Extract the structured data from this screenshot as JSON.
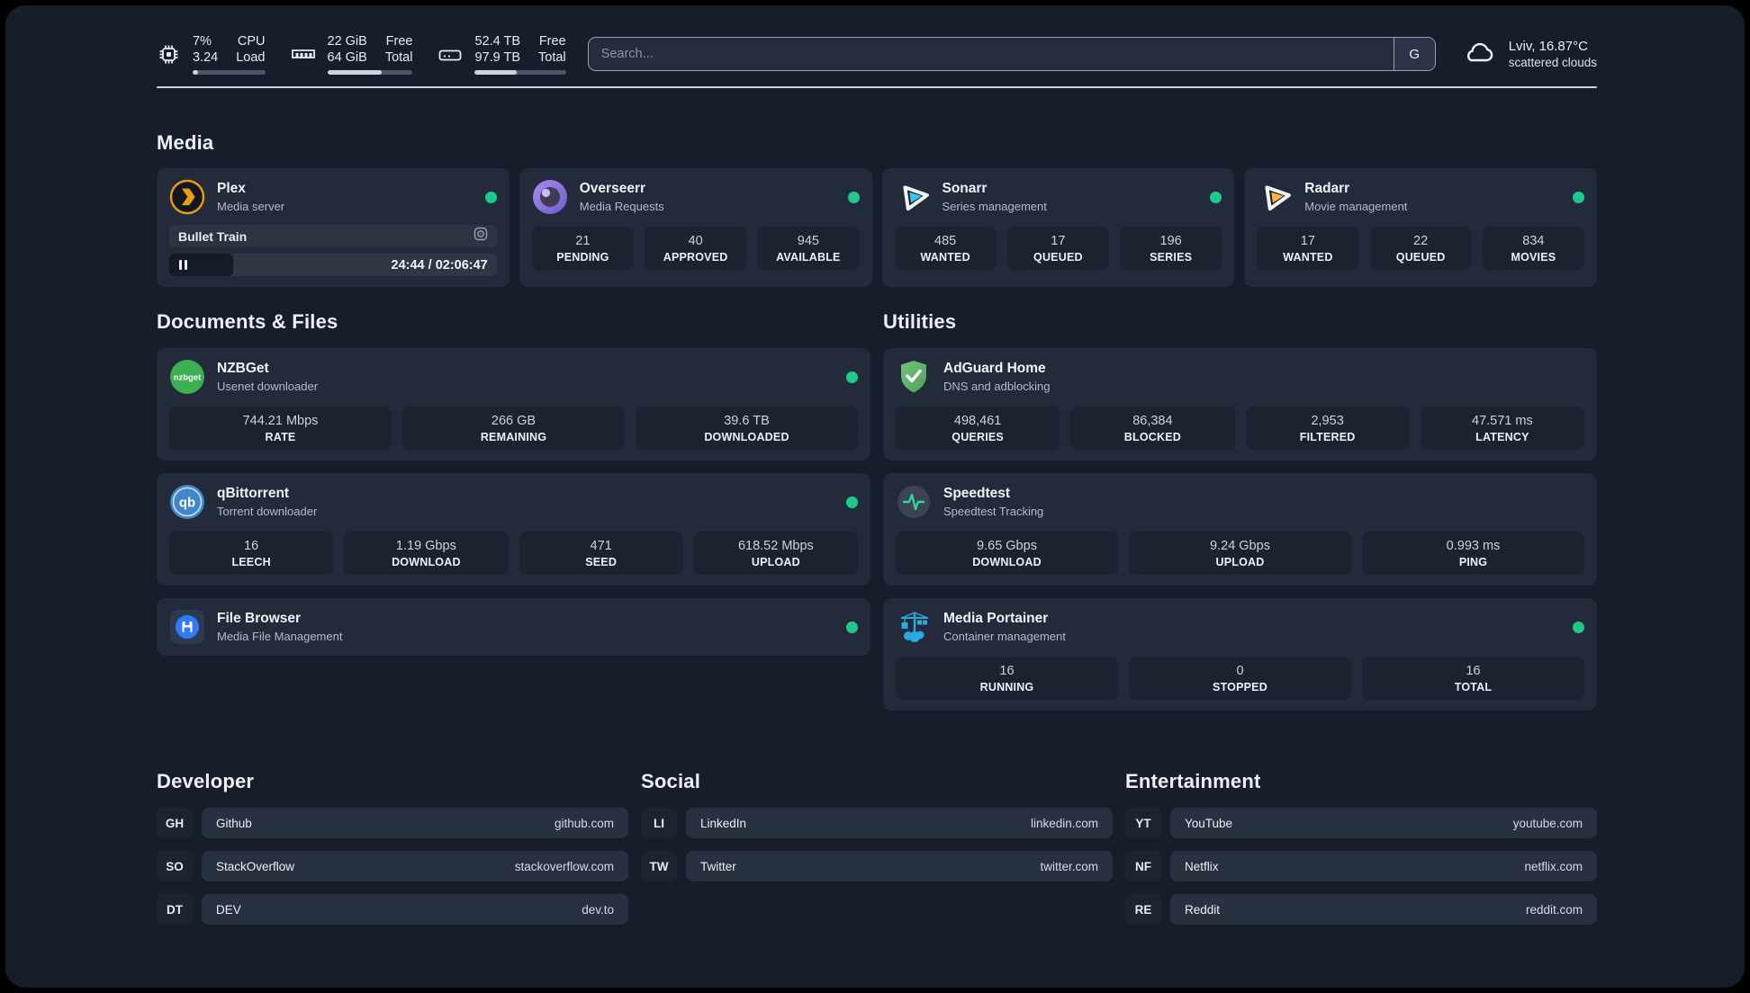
{
  "colors": {
    "status_online": "#1fc98c",
    "plex_accent": "#e5a00d",
    "sonarr_accent": "#36c6f2",
    "radarr_accent": "#ffb53c",
    "nzbget_accent": "#3daf52",
    "qbittorrent_accent": "#3e87cc",
    "adguard_accent": "#5fb46a",
    "speedtest_accent": "#35d49e",
    "portainer_accent": "#29a9e1"
  },
  "topbar": {
    "cpu": {
      "value1": "7%",
      "label1": "CPU",
      "value2": "3.24",
      "label2": "Load"
    },
    "memory": {
      "value1": "22 GiB",
      "label1": "Free",
      "value2": "64 GiB",
      "label2": "Total"
    },
    "storage": {
      "value1": "52.4 TB",
      "label1": "Free",
      "value2": "97.9 TB",
      "label2": "Total"
    },
    "search": {
      "placeholder": "Search...",
      "engine_button": "G"
    },
    "weather": {
      "location": "Lviv, 16.87°C",
      "condition": "scattered clouds"
    }
  },
  "sections": {
    "media": "Media",
    "documents": "Documents & Files",
    "utilities": "Utilities",
    "developer": "Developer",
    "social": "Social",
    "entertainment": "Entertainment"
  },
  "apps": {
    "plex": {
      "name": "Plex",
      "description": "Media server",
      "status": "online",
      "now_playing": {
        "title": "Bullet Train",
        "elapsed": "24:44",
        "duration": "02:06:47",
        "time_display": "24:44 / 02:06:47",
        "progress_percent": 19.5
      }
    },
    "overseerr": {
      "name": "Overseerr",
      "description": "Media Requests",
      "status": "online",
      "stats": [
        {
          "value": "21",
          "label": "PENDING"
        },
        {
          "value": "40",
          "label": "APPROVED"
        },
        {
          "value": "945",
          "label": "AVAILABLE"
        }
      ]
    },
    "sonarr": {
      "name": "Sonarr",
      "description": "Series management",
      "status": "online",
      "stats": [
        {
          "value": "485",
          "label": "WANTED"
        },
        {
          "value": "17",
          "label": "QUEUED"
        },
        {
          "value": "196",
          "label": "SERIES"
        }
      ]
    },
    "radarr": {
      "name": "Radarr",
      "description": "Movie management",
      "status": "online",
      "stats": [
        {
          "value": "17",
          "label": "WANTED"
        },
        {
          "value": "22",
          "label": "QUEUED"
        },
        {
          "value": "834",
          "label": "MOVIES"
        }
      ]
    },
    "nzbget": {
      "name": "NZBGet",
      "description": "Usenet downloader",
      "status": "online",
      "badge": "nzbget",
      "stats": [
        {
          "value": "744.21 Mbps",
          "label": "RATE"
        },
        {
          "value": "266 GB",
          "label": "REMAINING"
        },
        {
          "value": "39.6 TB",
          "label": "DOWNLOADED"
        }
      ]
    },
    "qbittorrent": {
      "name": "qBittorrent",
      "description": "Torrent downloader",
      "status": "online",
      "badge": "qb",
      "stats": [
        {
          "value": "16",
          "label": "LEECH"
        },
        {
          "value": "1.19 Gbps",
          "label": "DOWNLOAD"
        },
        {
          "value": "471",
          "label": "SEED"
        },
        {
          "value": "618.52 Mbps",
          "label": "UPLOAD"
        }
      ]
    },
    "filebrowser": {
      "name": "File Browser",
      "description": "Media File Management",
      "status": "online"
    },
    "adguard": {
      "name": "AdGuard Home",
      "description": "DNS and adblocking",
      "stats": [
        {
          "value": "498,461",
          "label": "QUERIES"
        },
        {
          "value": "86,384",
          "label": "BLOCKED"
        },
        {
          "value": "2,953",
          "label": "FILTERED"
        },
        {
          "value": "47.571 ms",
          "label": "LATENCY"
        }
      ]
    },
    "speedtest": {
      "name": "Speedtest",
      "description": "Speedtest Tracking",
      "stats": [
        {
          "value": "9.65 Gbps",
          "label": "DOWNLOAD"
        },
        {
          "value": "9.24 Gbps",
          "label": "UPLOAD"
        },
        {
          "value": "0.993 ms",
          "label": "PING"
        }
      ]
    },
    "portainer": {
      "name": "Media Portainer",
      "description": "Container management",
      "status": "online",
      "stats": [
        {
          "value": "16",
          "label": "RUNNING"
        },
        {
          "value": "0",
          "label": "STOPPED"
        },
        {
          "value": "16",
          "label": "TOTAL"
        }
      ]
    }
  },
  "links": {
    "developer": [
      {
        "abbr": "GH",
        "name": "Github",
        "url": "github.com"
      },
      {
        "abbr": "SO",
        "name": "StackOverflow",
        "url": "stackoverflow.com"
      },
      {
        "abbr": "DT",
        "name": "DEV",
        "url": "dev.to"
      }
    ],
    "social": [
      {
        "abbr": "LI",
        "name": "LinkedIn",
        "url": "linkedin.com"
      },
      {
        "abbr": "TW",
        "name": "Twitter",
        "url": "twitter.com"
      }
    ],
    "entertainment": [
      {
        "abbr": "YT",
        "name": "YouTube",
        "url": "youtube.com"
      },
      {
        "abbr": "NF",
        "name": "Netflix",
        "url": "netflix.com"
      },
      {
        "abbr": "RE",
        "name": "Reddit",
        "url": "reddit.com"
      }
    ]
  }
}
